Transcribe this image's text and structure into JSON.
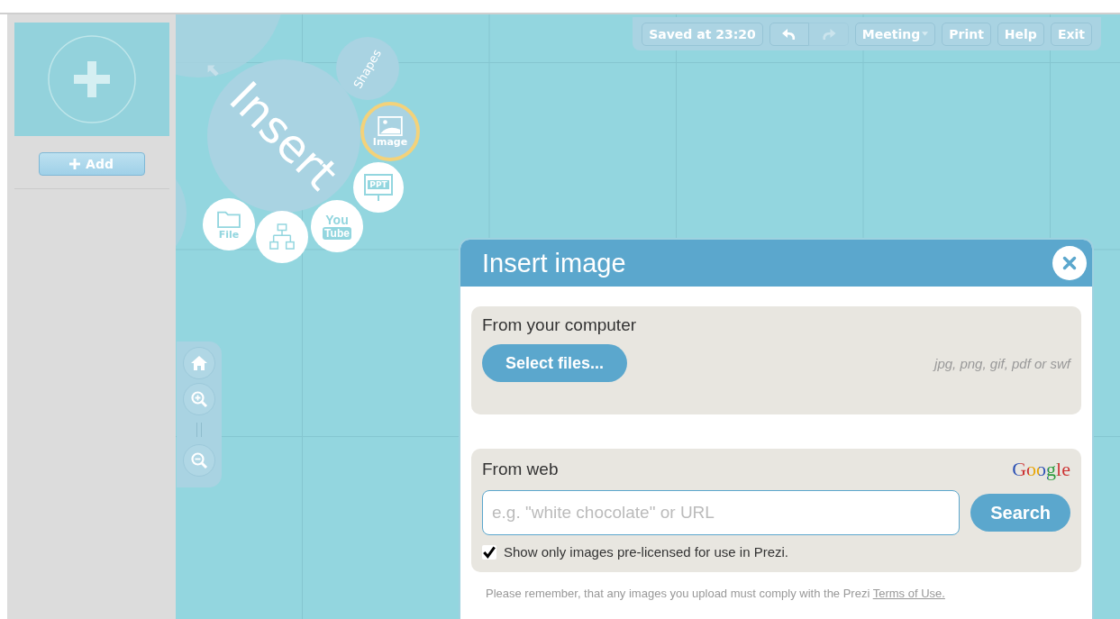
{
  "toolbar": {
    "status": "Saved at 23:20",
    "undo": {
      "disabled": false
    },
    "redo": {
      "disabled": true
    },
    "buttons": [
      {
        "label": "Meeting",
        "kind": "dropdown"
      },
      {
        "label": "Print",
        "kind": "plain"
      },
      {
        "label": "Help",
        "kind": "plain"
      },
      {
        "label": "Exit",
        "kind": "plain"
      }
    ]
  },
  "sidebar": {
    "add_button": "Add"
  },
  "insert_menu": {
    "title": "Insert",
    "items": [
      {
        "kind": "shapes",
        "lines": [
          "Shapes"
        ],
        "selected": false
      },
      {
        "kind": "image",
        "lines": [
          "Image"
        ],
        "selected": true
      },
      {
        "kind": "ppt",
        "lines": [
          "PPT"
        ],
        "selected": false
      },
      {
        "kind": "youtube",
        "lines": [
          "You",
          "Tube"
        ],
        "selected": false
      },
      {
        "kind": "diagram",
        "selected": false
      },
      {
        "kind": "file",
        "lines": [
          "File"
        ],
        "selected": false
      }
    ]
  },
  "dialog": {
    "title": "Insert image",
    "computer": {
      "heading": "From your computer",
      "button": "Select files...",
      "formats": "jpg, png, gif, pdf or swf"
    },
    "web": {
      "heading": "From web",
      "provider": "Google",
      "search": {
        "placeholder": "e.g. \"white chocolate\" or URL"
      },
      "button": "Search",
      "filter": {
        "label": "Show only images pre-licensed for use in Prezi.",
        "checked": true
      }
    },
    "note": "Please remember, that any images you upload must comply with the Prezi",
    "note_link": "Terms of Use."
  }
}
